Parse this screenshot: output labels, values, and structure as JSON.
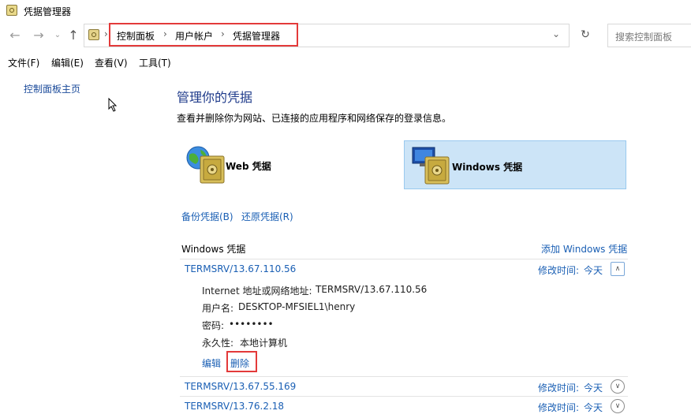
{
  "window": {
    "title": "凭据管理器",
    "icon": "credential-manager-icon"
  },
  "nav": {
    "back_icon": "back-arrow-icon",
    "forward_icon": "forward-arrow-icon",
    "recent_icon": "chevron-down-icon",
    "up_icon": "up-arrow-icon",
    "breadcrumb": [
      "控制面板",
      "用户帐户",
      "凭据管理器"
    ],
    "separator": "›",
    "dropdown_glyph": "⌄",
    "refresh_glyph": "↻",
    "search_placeholder": "搜索控制面板"
  },
  "menu": [
    "文件(F)",
    "编辑(E)",
    "查看(V)",
    "工具(T)"
  ],
  "sidebar": {
    "home_link": "控制面板主页"
  },
  "main": {
    "heading": "管理你的凭据",
    "subtext": "查看并删除你为网站、已连接的应用程序和网络保存的登录信息。",
    "cards": [
      {
        "label": "Web 凭据",
        "icon": "globe-vault-icon",
        "selected": false
      },
      {
        "label": "Windows 凭据",
        "icon": "monitor-vault-icon",
        "selected": true
      }
    ],
    "backup_link": "备份凭据(B)",
    "restore_link": "还原凭据(R)",
    "section_title": "Windows 凭据",
    "add_link": "添加 Windows 凭据",
    "entries": [
      {
        "name": "TERMSRV/13.67.110.56",
        "modified_label": "修改时间:",
        "modified": "今天",
        "expanded": true,
        "details": {
          "address_label": "Internet 地址或网络地址:",
          "address": "TERMSRV/13.67.110.56",
          "user_label": "用户名:",
          "user": "DESKTOP-MFSIEL1\\henry",
          "password_label": "密码:",
          "password": "••••••••",
          "persistence_label": "永久性:",
          "persistence": "本地计算机"
        },
        "edit_link": "编辑",
        "delete_link": "删除"
      },
      {
        "name": "TERMSRV/13.67.55.169",
        "modified_label": "修改时间:",
        "modified": "今天",
        "expanded": false
      },
      {
        "name": "TERMSRV/13.76.2.18",
        "modified_label": "修改时间:",
        "modified": "今天",
        "expanded": false
      }
    ]
  },
  "colors": {
    "link": "#1a5fb4",
    "heading": "#1e3a8a",
    "selected_bg": "#cce4f7",
    "highlight_red": "#e33a3a"
  }
}
